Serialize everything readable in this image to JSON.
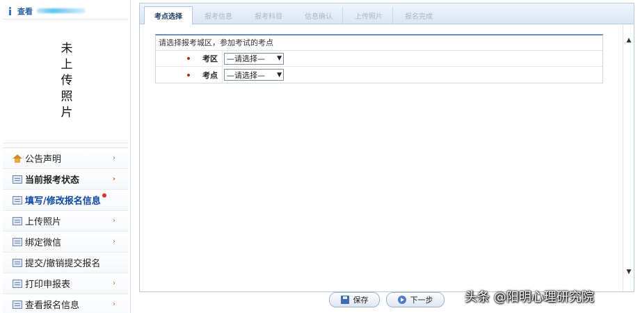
{
  "sidebar": {
    "user_label": "查看",
    "photo_text": "未上传照片",
    "menu": [
      {
        "label": "公告声明",
        "icon": "home-icon"
      },
      {
        "label": "当前报考状态",
        "icon": "form-icon"
      },
      {
        "label": "填写/修改报名信息",
        "icon": "form-icon"
      },
      {
        "label": "上传照片",
        "icon": "form-icon"
      },
      {
        "label": "绑定微信",
        "icon": "form-icon"
      },
      {
        "label": "提交/撤销提交报名",
        "icon": "form-icon"
      },
      {
        "label": "打印申报表",
        "icon": "form-icon"
      },
      {
        "label": "查看报名信息",
        "icon": "form-icon"
      }
    ],
    "chevron": "›"
  },
  "tabs": [
    {
      "label": "考点选择"
    },
    {
      "label": "报考信息"
    },
    {
      "label": "报考科目"
    },
    {
      "label": "信息确认"
    },
    {
      "label": "上传照片"
    },
    {
      "label": "报名完成"
    }
  ],
  "form": {
    "hint": "请选择报考城区，参加考试的考点",
    "rows": [
      {
        "label": "考区",
        "select_value": "—请选择—"
      },
      {
        "label": "考点",
        "select_value": "—请选择—"
      }
    ]
  },
  "buttons": {
    "save": "保存",
    "next": "下一步"
  },
  "watermark": "头条 @阳明心理研究院"
}
